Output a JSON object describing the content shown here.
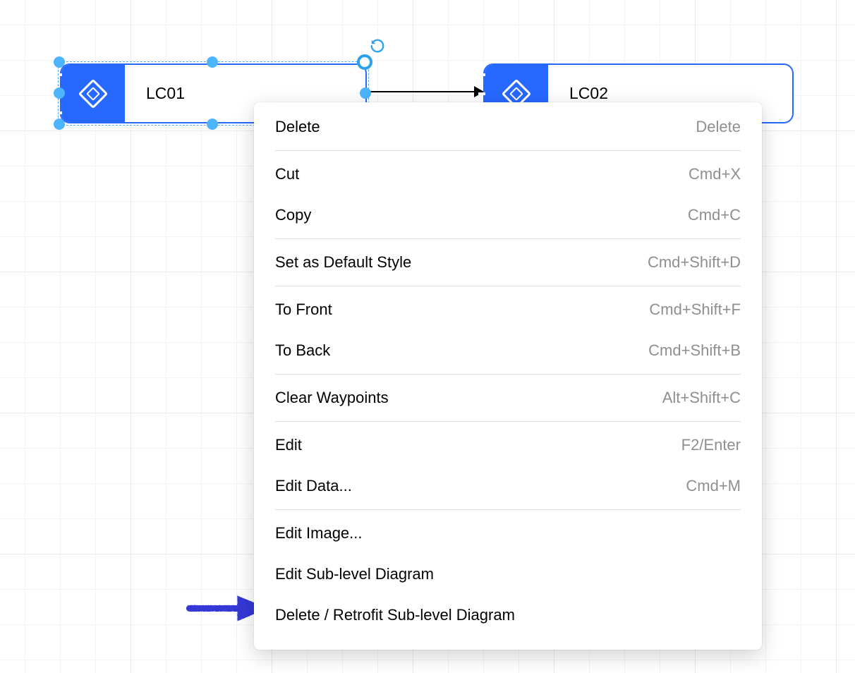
{
  "nodes": {
    "lc01": {
      "label": "LC01"
    },
    "lc02": {
      "label": "LC02"
    }
  },
  "context_menu": {
    "items": [
      {
        "label": "Delete",
        "shortcut": "Delete"
      },
      {
        "label": "Cut",
        "shortcut": "Cmd+X"
      },
      {
        "label": "Copy",
        "shortcut": "Cmd+C"
      },
      {
        "label": "Set as Default Style",
        "shortcut": "Cmd+Shift+D"
      },
      {
        "label": "To Front",
        "shortcut": "Cmd+Shift+F"
      },
      {
        "label": "To Back",
        "shortcut": "Cmd+Shift+B"
      },
      {
        "label": "Clear Waypoints",
        "shortcut": "Alt+Shift+C"
      },
      {
        "label": "Edit",
        "shortcut": "F2/Enter"
      },
      {
        "label": "Edit Data...",
        "shortcut": "Cmd+M"
      },
      {
        "label": "Edit Image...",
        "shortcut": ""
      },
      {
        "label": "Edit Sub-level Diagram",
        "shortcut": ""
      },
      {
        "label": "Delete / Retrofit Sub-level Diagram",
        "shortcut": ""
      }
    ]
  },
  "colors": {
    "primary": "#2768ff",
    "handle": "#4db4ff"
  }
}
